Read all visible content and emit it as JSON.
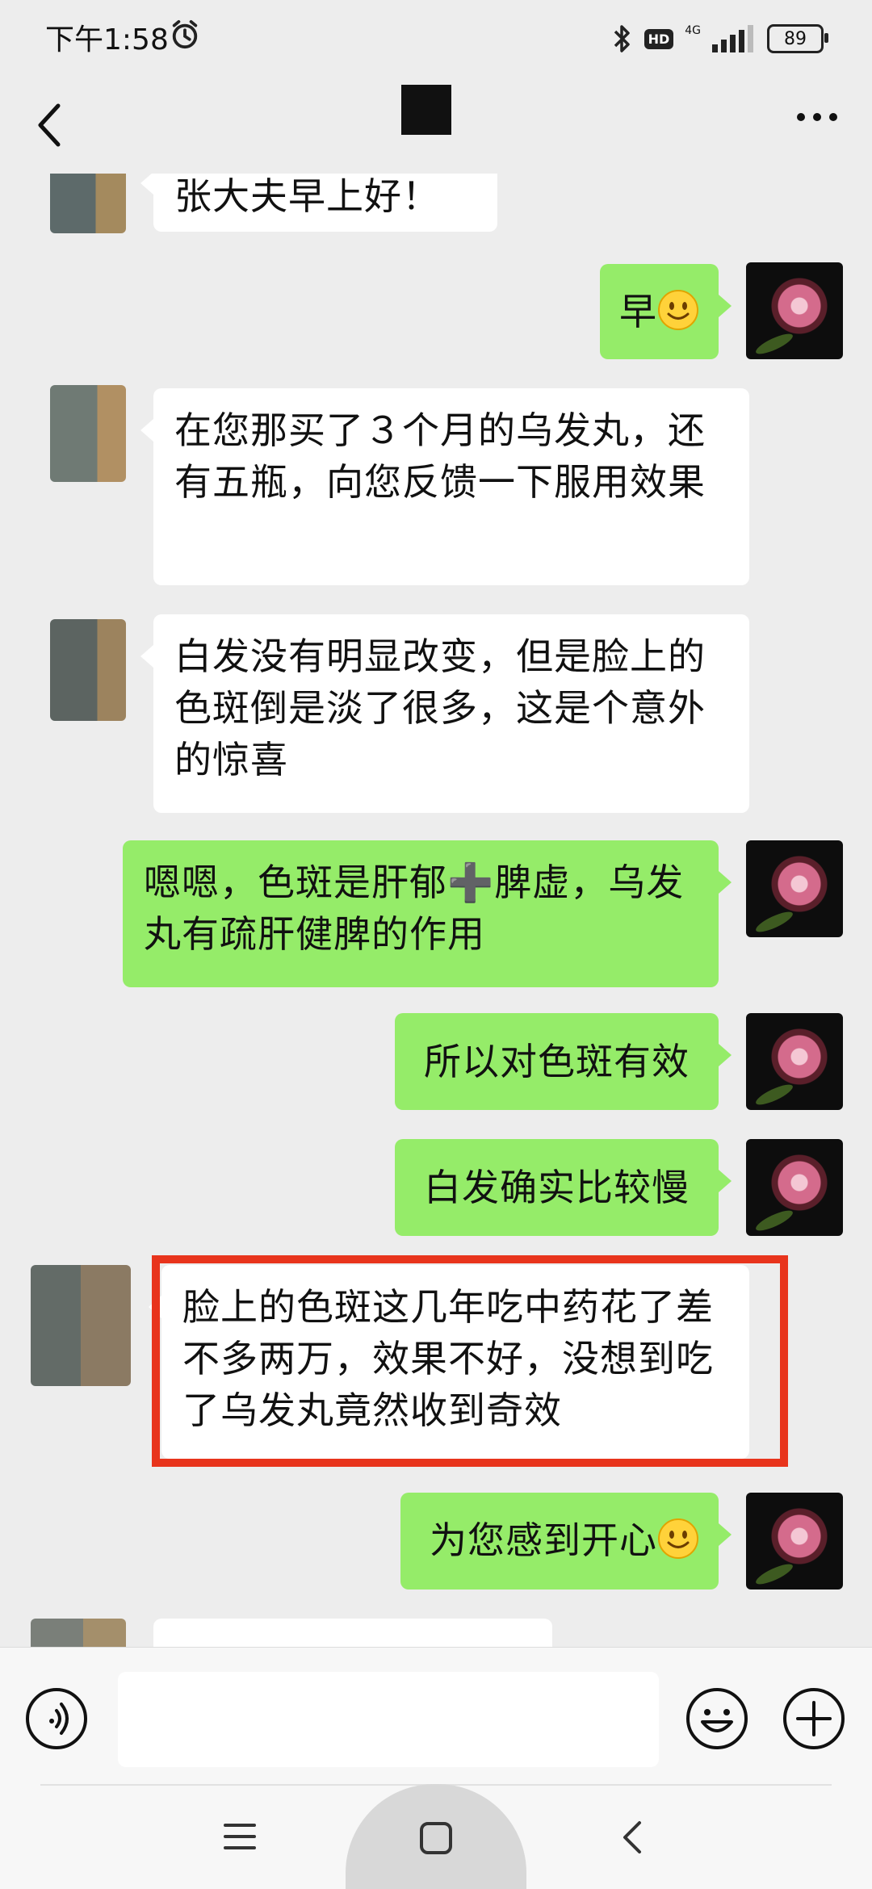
{
  "status_bar": {
    "time": "下午1:58",
    "hd_badge": "HD",
    "network": "4G",
    "battery": "89"
  },
  "colors": {
    "incoming_bubble": "#ffffff",
    "outgoing_bubble": "#95ec69",
    "background": "#ededed",
    "highlight_border": "#e8341c"
  },
  "messages": [
    {
      "side": "in",
      "text": "张大夫早上好！"
    },
    {
      "side": "out",
      "text": "早",
      "emoji": "smile"
    },
    {
      "side": "in",
      "text": "在您那买了３个月的乌发丸，还有五瓶，向您反馈一下服用效果"
    },
    {
      "side": "in",
      "text": "白发没有明显改变，但是脸上的色斑倒是淡了很多，这是个意外的惊喜"
    },
    {
      "side": "out",
      "text": "嗯嗯，色斑是肝郁➕脾虚，乌发丸有疏肝健脾的作用"
    },
    {
      "side": "out",
      "text": "所以对色斑有效"
    },
    {
      "side": "out",
      "text": "白发确实比较慢"
    },
    {
      "side": "in",
      "text": "脸上的色斑这几年吃中药花了差不多两万，效果不好，没想到吃了乌发丸竟然收到奇效",
      "highlighted": true
    },
    {
      "side": "out",
      "text": "为您感到开心",
      "emoji": "smile"
    }
  ],
  "icons": {
    "back": "chevron-left-icon",
    "more": "more-dots-icon",
    "voice": "voice-icon",
    "emoji": "emoji-icon",
    "plus": "plus-icon"
  },
  "input": {
    "value": "",
    "placeholder": ""
  }
}
